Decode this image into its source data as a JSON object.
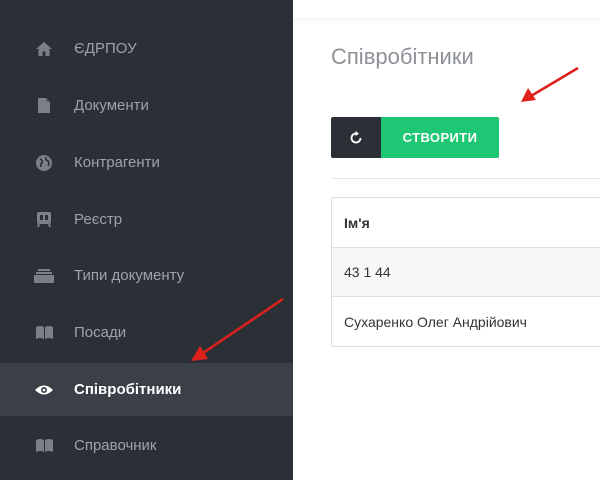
{
  "sidebar": {
    "items": [
      {
        "label": "ЄДРПОУ",
        "icon": "home-icon"
      },
      {
        "label": "Документи",
        "icon": "document-icon"
      },
      {
        "label": "Контрагенти",
        "icon": "globe-icon"
      },
      {
        "label": "Реєстр",
        "icon": "register-icon"
      },
      {
        "label": "Типи документу",
        "icon": "stack-icon"
      },
      {
        "label": "Посади",
        "icon": "book-icon"
      },
      {
        "label": "Співробітники",
        "icon": "eye-icon",
        "active": true
      },
      {
        "label": "Справочник",
        "icon": "book-icon"
      }
    ]
  },
  "main": {
    "title": "Співробітники",
    "toolbar": {
      "refresh_icon": "refresh-icon",
      "create_label": "СТВОРИТИ"
    },
    "table": {
      "header": "Ім'я",
      "rows": [
        "43 1 44",
        "Сухаренко Олег Андрійович"
      ]
    }
  },
  "colors": {
    "sidebar_bg": "#2b2f36",
    "sidebar_active_bg": "#3b4048",
    "create_button": "#1ec774",
    "annotation_arrow": "#e0201b"
  }
}
